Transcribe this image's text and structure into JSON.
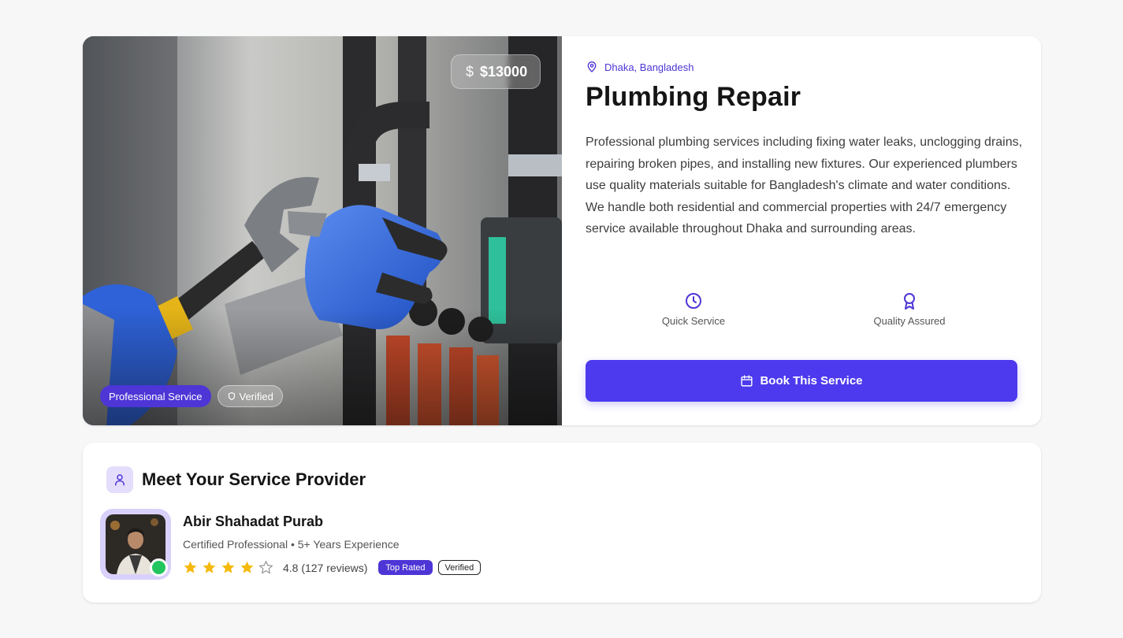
{
  "service": {
    "price": "$13000",
    "price_icon": "dollar-icon",
    "badges": {
      "professional": "Professional Service",
      "verified": "Verified"
    },
    "location": "Dhaka, Bangladesh",
    "title": "Plumbing Repair",
    "description": "Professional plumbing services including fixing water leaks, unclogging drains, repairing broken pipes, and installing new fixtures. Our experienced plumbers use quality materials suitable for Bangladesh's climate and water conditions. We handle both residential and commercial properties with 24/7 emergency service available throughout Dhaka and surrounding areas.",
    "features": [
      {
        "label": "Quick Service",
        "icon": "clock-icon"
      },
      {
        "label": "Quality Assured",
        "icon": "award-icon"
      }
    ],
    "book_label": "Book This Service",
    "accent_color": "#4d3aee"
  },
  "provider": {
    "heading": "Meet Your Service Provider",
    "name": "Abir Shahadat Purab",
    "subtitle": "Certified Professional • 5+ Years Experience",
    "rating": 4,
    "rating_text": "4.8 (127 reviews)",
    "badges": {
      "top_rated": "Top Rated",
      "verified": "Verified"
    },
    "online_color": "#22c55e"
  }
}
